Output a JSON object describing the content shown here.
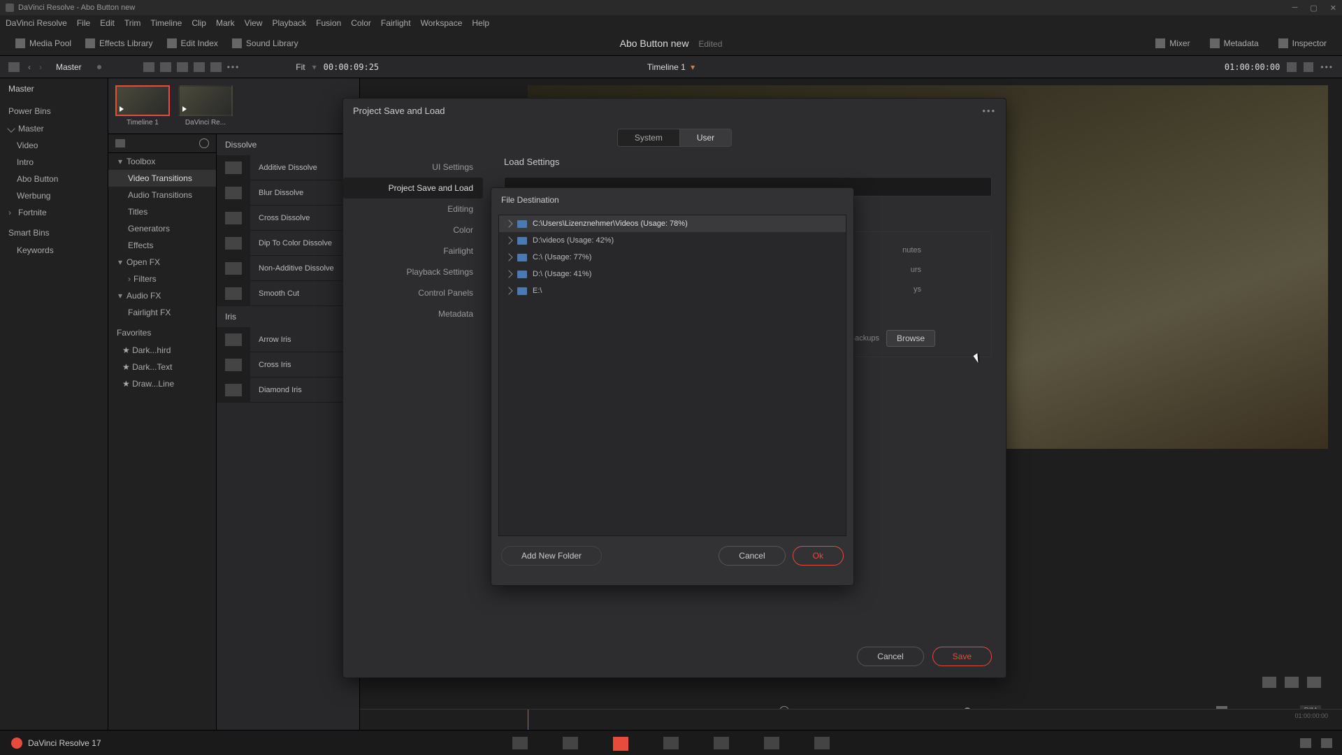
{
  "titlebar": "DaVinci Resolve - Abo Button new",
  "menu": [
    "DaVinci Resolve",
    "File",
    "Edit",
    "Trim",
    "Timeline",
    "Clip",
    "Mark",
    "View",
    "Playback",
    "Fusion",
    "Color",
    "Fairlight",
    "Workspace",
    "Help"
  ],
  "toolbar": {
    "media_pool": "Media Pool",
    "effects_library": "Effects Library",
    "edit_index": "Edit Index",
    "sound_library": "Sound Library",
    "mixer": "Mixer",
    "metadata": "Metadata",
    "inspector": "Inspector"
  },
  "project": {
    "name": "Abo Button new",
    "status": "Edited"
  },
  "subbar": {
    "master": "Master",
    "fit": "Fit",
    "timecode_in": "00:00:09:25",
    "timeline": "Timeline 1",
    "timecode_out": "01:00:00:00"
  },
  "left": {
    "master": "Master",
    "power_bins": "Power Bins",
    "bins": [
      "Master",
      "Video",
      "Intro",
      "Abo Button",
      "Werbung",
      "Fortnite"
    ],
    "smart_bins": "Smart Bins",
    "smart": [
      "Keywords"
    ]
  },
  "clips": [
    {
      "name": "Timeline 1"
    },
    {
      "name": "DaVinci Re..."
    }
  ],
  "fx_tree": {
    "toolbox": "Toolbox",
    "cats": [
      "Video Transitions",
      "Audio Transitions",
      "Titles",
      "Generators",
      "Effects"
    ],
    "openfx": "Open FX",
    "filters": "Filters",
    "audiofx": "Audio FX",
    "fairlightfx": "Fairlight FX",
    "favorites": "Favorites",
    "favs": [
      "Dark...hird",
      "Dark...Text",
      "Draw...Line"
    ]
  },
  "fx_groups": [
    {
      "header": "Dissolve",
      "items": [
        "Additive Dissolve",
        "Blur Dissolve",
        "Cross Dissolve",
        "Dip To Color Dissolve",
        "Non-Additive Dissolve",
        "Smooth Cut"
      ]
    },
    {
      "header": "Iris",
      "items": [
        "Arrow Iris",
        "Cross Iris",
        "Diamond Iris"
      ]
    }
  ],
  "dialog": {
    "title": "Project Save and Load",
    "tabs": {
      "system": "System",
      "user": "User"
    },
    "sidebar": [
      "UI Settings",
      "Project Save and Load",
      "Editing",
      "Color",
      "Fairlight",
      "Playback Settings",
      "Control Panels",
      "Metadata"
    ],
    "content_header": "Load Settings",
    "hints": [
      "nutes",
      "urs",
      "ys",
      "ct Backups"
    ],
    "browse": "Browse",
    "cancel": "Cancel",
    "save": "Save"
  },
  "file_dialog": {
    "title": "File Destination",
    "items": [
      "C:\\Users\\Lizenznehmer\\Videos (Usage: 78%)",
      "D:\\videos (Usage: 42%)",
      "C:\\ (Usage: 77%)",
      "D:\\ (Usage: 41%)",
      "E:\\"
    ],
    "add_folder": "Add New Folder",
    "cancel": "Cancel",
    "ok": "Ok"
  },
  "timeline_ticks": [
    "01:00:00:00"
  ],
  "pagebar": {
    "label": "DaVinci Resolve 17"
  }
}
